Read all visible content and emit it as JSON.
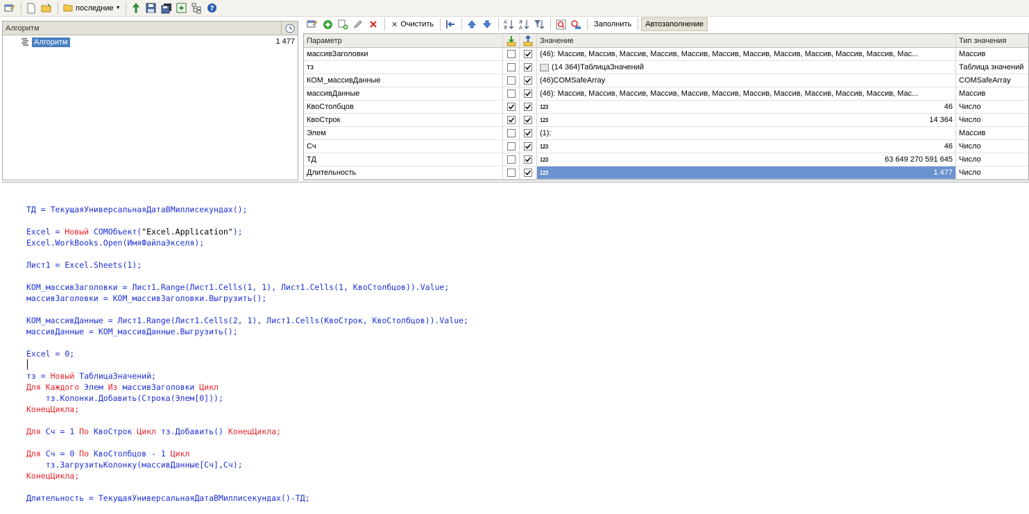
{
  "toolbar": {
    "recent_label": "последние"
  },
  "left_panel": {
    "header": "Алгоритм",
    "row_label": "Алгоритм",
    "row_value": "1 477"
  },
  "right_toolbar": {
    "clear_label": "Очистить",
    "fill_label": "Заполнить",
    "autofill_label": "Автозаполнение"
  },
  "param_table": {
    "headers": {
      "name": "Параметр",
      "value": "Значение",
      "type": "Тип значения"
    },
    "rows": [
      {
        "name": "массивЗаголовки",
        "in": false,
        "out": true,
        "value": "(46): Массив, Массив, Массив, Массив, Массив, Массив, Массив, Массив, Массив, Массив, Массив, Мас...",
        "value_kind": "text",
        "type": "Массив"
      },
      {
        "name": "тз",
        "in": false,
        "out": true,
        "value": "(14 364)ТаблицаЗначений",
        "value_kind": "table",
        "type": "Таблица значений"
      },
      {
        "name": "КОМ_массивДанные",
        "in": false,
        "out": true,
        "value": "(46)COMSafeArray",
        "value_kind": "text",
        "type": "COMSafeArray"
      },
      {
        "name": "массивДанные",
        "in": false,
        "out": true,
        "value": "(46): Массив, Массив, Массив, Массив, Массив, Массив, Массив, Массив, Массив, Массив, Массив, Мас...",
        "value_kind": "text",
        "type": "Массив"
      },
      {
        "name": "КвоСтолбцов",
        "in": true,
        "out": true,
        "value": "46",
        "value_kind": "number",
        "type": "Число"
      },
      {
        "name": "КвоСтрок",
        "in": true,
        "out": true,
        "value": "14 364",
        "value_kind": "number",
        "type": "Число"
      },
      {
        "name": "Элем",
        "in": false,
        "out": true,
        "value": "(1):",
        "value_kind": "text",
        "type": "Массив"
      },
      {
        "name": "Сч",
        "in": false,
        "out": true,
        "value": "46",
        "value_kind": "number",
        "type": "Число"
      },
      {
        "name": "ТД",
        "in": false,
        "out": true,
        "value": "63 649 270 591 645",
        "value_kind": "number",
        "type": "Число"
      },
      {
        "name": "Длительность",
        "in": false,
        "out": true,
        "value": "1 477",
        "value_kind": "number",
        "type": "Число",
        "selected": true
      }
    ]
  },
  "code": {
    "keyword_color": "#e8232a",
    "identifier_color": "#1c2fd6",
    "lines": [
      [
        {
          "t": "ТД = ТекущаяУниверсальнаяДатаВМиллисекундах();",
          "c": "b"
        }
      ],
      [],
      [
        {
          "t": "Excel = ",
          "c": "b"
        },
        {
          "t": "Новый",
          "c": "r"
        },
        {
          "t": " COMОбъект(",
          "c": "b"
        },
        {
          "t": "\"Excel.Application\"",
          "c": "k"
        },
        {
          "t": ");",
          "c": "b"
        }
      ],
      [
        {
          "t": "Excel.WorkBooks.Open(ИмяФайлаЭкселя);",
          "c": "b"
        }
      ],
      [],
      [
        {
          "t": "Лист1 = Excel.Sheets(1);",
          "c": "b"
        }
      ],
      [],
      [
        {
          "t": "КОМ_массивЗаголовки = Лист1.Range(Лист1.Cells(1, 1), Лист1.Cells(1, КвоСтолбцов)).Value;",
          "c": "b"
        }
      ],
      [
        {
          "t": "массивЗаголовки = КОМ_массивЗаголовки.Выгрузить();",
          "c": "b"
        }
      ],
      [],
      [
        {
          "t": "КОМ_массивДанные = Лист1.Range(Лист1.Cells(2, 1), Лист1.Cells(КвоСтрок, КвоСтолбцов)).Value;",
          "c": "b"
        }
      ],
      [
        {
          "t": "массивДанные = КОМ_массивДанные.Выгрузить();",
          "c": "b"
        }
      ],
      [],
      [
        {
          "t": "Excel = 0;",
          "c": "b"
        }
      ],
      [],
      [
        {
          "t": "тз = ",
          "c": "b"
        },
        {
          "t": "Новый",
          "c": "r"
        },
        {
          "t": " ТаблицаЗначений;",
          "c": "b"
        }
      ],
      [
        {
          "t": "Для Каждого",
          "c": "r"
        },
        {
          "t": " Элем ",
          "c": "b"
        },
        {
          "t": "Из",
          "c": "r"
        },
        {
          "t": " массивЗаголовки ",
          "c": "b"
        },
        {
          "t": "Цикл",
          "c": "r"
        }
      ],
      [
        {
          "t": "    тз.Колонки.Добавить(Строка(Элем[0]));",
          "c": "b"
        }
      ],
      [
        {
          "t": "КонецЦикла;",
          "c": "r"
        }
      ],
      [],
      [
        {
          "t": "Для",
          "c": "r"
        },
        {
          "t": " Сч = 1 ",
          "c": "b"
        },
        {
          "t": "По",
          "c": "r"
        },
        {
          "t": " КвоСтрок ",
          "c": "b"
        },
        {
          "t": "Цикл",
          "c": "r"
        },
        {
          "t": " тз.Добавить() ",
          "c": "b"
        },
        {
          "t": "КонецЦикла;",
          "c": "r"
        }
      ],
      [],
      [
        {
          "t": "Для",
          "c": "r"
        },
        {
          "t": " Сч = 0 ",
          "c": "b"
        },
        {
          "t": "По",
          "c": "r"
        },
        {
          "t": " КвоСтолбцов - 1 ",
          "c": "b"
        },
        {
          "t": "Цикл",
          "c": "r"
        }
      ],
      [
        {
          "t": "    тз.ЗагрузитьКолонку(массивДанные[Сч],Сч);",
          "c": "b"
        }
      ],
      [
        {
          "t": "КонецЦикла;",
          "c": "r"
        }
      ],
      [],
      [
        {
          "t": "Длительность = ТекущаяУниверсальнаяДатаВМиллисекундах()-ТД;",
          "c": "b"
        }
      ]
    ]
  }
}
